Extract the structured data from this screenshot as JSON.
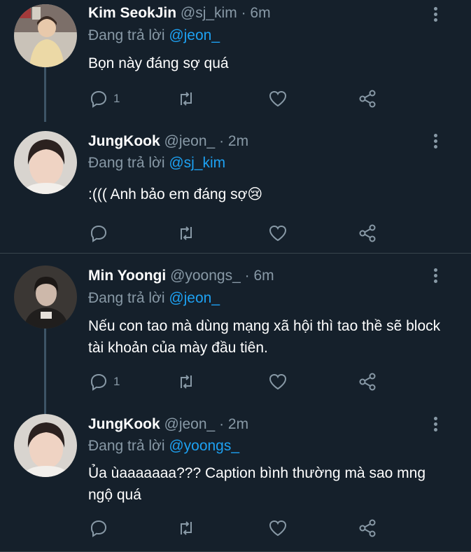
{
  "reply_prefix": "Đang trả lời",
  "tweets": [
    {
      "name": "Kim SeokJin",
      "handle": "@sj_kim",
      "dot": "·",
      "time": "6m",
      "reply_to": "@jeon_",
      "text": "Bọn này đáng sợ quá",
      "reply_count": "1",
      "retweet_count": "",
      "like_count": ""
    },
    {
      "name": "JungKook",
      "handle": "@jeon_",
      "dot": "·",
      "time": "2m",
      "reply_to": "@sj_kim",
      "text": ":((( Anh bảo em đáng sợ😢",
      "reply_count": "",
      "retweet_count": "",
      "like_count": ""
    },
    {
      "name": "Min Yoongi",
      "handle": "@yoongs_",
      "dot": "·",
      "time": "6m",
      "reply_to": "@jeon_",
      "text": "Nếu con tao mà dùng mạng xã hội thì tao thề sẽ block tài khoản của mày đầu tiên.",
      "reply_count": "1",
      "retweet_count": "",
      "like_count": ""
    },
    {
      "name": "JungKook",
      "handle": "@jeon_",
      "dot": "·",
      "time": "2m",
      "reply_to": "@yoongs_",
      "text": "Ủa ùaaaaaaa??? Caption bình thường mà sao mng ngộ quá",
      "reply_count": "",
      "retweet_count": "",
      "like_count": ""
    }
  ],
  "colors": {
    "background": "#15202b",
    "secondary_text": "#8899a6",
    "mention": "#1da1f2",
    "divider": "#38444d"
  }
}
